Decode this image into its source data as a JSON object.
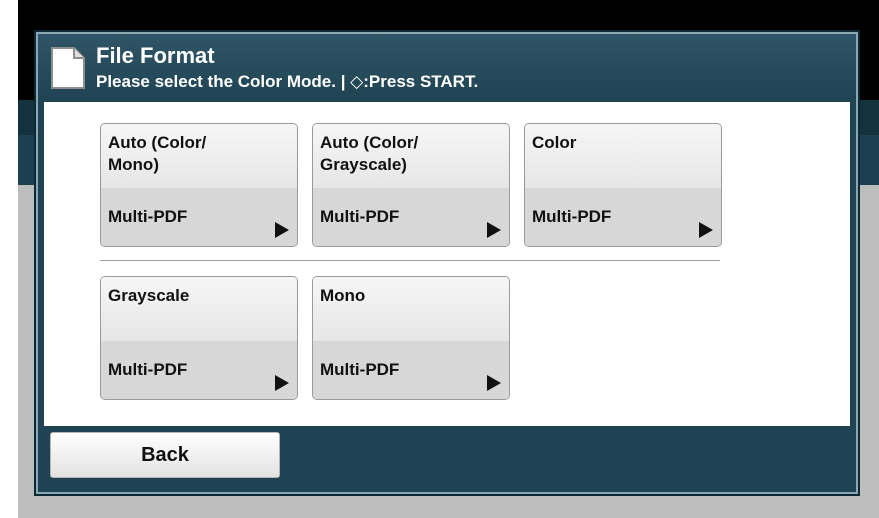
{
  "dialog": {
    "title": "File Format",
    "subtitle": "Please select the Color Mode. | ◇:Press START.",
    "icon": "document-icon"
  },
  "modes": [
    {
      "label": "Auto (Color/\nMono)",
      "format": "Multi-PDF"
    },
    {
      "label": "Auto (Color/\nGrayscale)",
      "format": "Multi-PDF"
    },
    {
      "label": "Color",
      "format": "Multi-PDF"
    },
    {
      "label": "Grayscale",
      "format": "Multi-PDF"
    },
    {
      "label": "Mono",
      "format": "Multi-PDF"
    }
  ],
  "footer": {
    "back_label": "Back"
  },
  "colors": {
    "dialog_frame": "#1f4352",
    "content_bg": "#ffffff",
    "button_bg": "#eeeeee"
  }
}
